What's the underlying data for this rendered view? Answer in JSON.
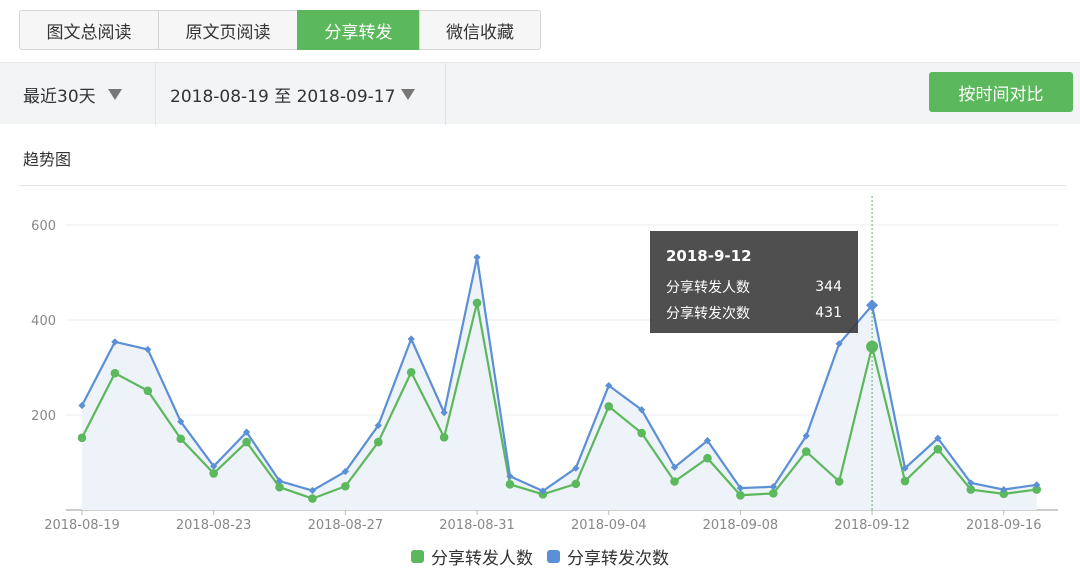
{
  "tabs": [
    {
      "label": "图文总阅读",
      "active": false
    },
    {
      "label": "原文页阅读",
      "active": false
    },
    {
      "label": "分享转发",
      "active": true
    },
    {
      "label": "微信收藏",
      "active": false
    }
  ],
  "filters": {
    "period": "最近30天",
    "date_range": "2018-08-19 至 2018-09-17",
    "compare_button": "按时间对比"
  },
  "section_title": "趋势图",
  "colors": {
    "accent": "#5cb85c",
    "series_green": "#5cb85c",
    "series_blue": "#5b8fd6"
  },
  "tooltip": {
    "date": "2018-9-12",
    "rows": [
      {
        "label": "分享转发人数",
        "value": "344"
      },
      {
        "label": "分享转发次数",
        "value": "431"
      }
    ]
  },
  "legend": [
    {
      "label": "分享转发人数",
      "color": "#5cb85c"
    },
    {
      "label": "分享转发次数",
      "color": "#5b8fd6"
    }
  ],
  "chart_data": {
    "type": "line",
    "title": "",
    "xlabel": "",
    "ylabel": "",
    "ylim": [
      0,
      600
    ],
    "yticks": [
      200,
      400,
      600
    ],
    "xtick_labels": [
      "2018-08-19",
      "2018-08-23",
      "2018-08-27",
      "2018-08-31",
      "2018-09-04",
      "2018-09-08",
      "2018-09-12",
      "2018-09-16"
    ],
    "xtick_index": [
      0,
      4,
      8,
      12,
      16,
      20,
      24,
      28
    ],
    "x": [
      "2018-08-19",
      "2018-08-20",
      "2018-08-21",
      "2018-08-22",
      "2018-08-23",
      "2018-08-24",
      "2018-08-25",
      "2018-08-26",
      "2018-08-27",
      "2018-08-28",
      "2018-08-29",
      "2018-08-30",
      "2018-08-31",
      "2018-09-01",
      "2018-09-02",
      "2018-09-03",
      "2018-09-04",
      "2018-09-05",
      "2018-09-06",
      "2018-09-07",
      "2018-09-08",
      "2018-09-09",
      "2018-09-10",
      "2018-09-11",
      "2018-09-12",
      "2018-09-13",
      "2018-09-14",
      "2018-09-15",
      "2018-09-16",
      "2018-09-17"
    ],
    "highlight_index": 24,
    "grid": true,
    "legend_position": "bottom",
    "series": [
      {
        "name": "分享转发人数",
        "color": "#5cb85c",
        "values": [
          152,
          288,
          251,
          150,
          77,
          143,
          48,
          24,
          50,
          143,
          290,
          153,
          436,
          54,
          33,
          55,
          218,
          162,
          60,
          109,
          31,
          35,
          123,
          60,
          344,
          61,
          128,
          43,
          34,
          43
        ]
      },
      {
        "name": "分享转发次数",
        "color": "#5b8fd6",
        "values": [
          220,
          354,
          338,
          186,
          92,
          164,
          61,
          41,
          81,
          178,
          360,
          205,
          532,
          71,
          40,
          88,
          262,
          211,
          90,
          146,
          46,
          49,
          156,
          350,
          431,
          88,
          151,
          57,
          43,
          53
        ]
      }
    ]
  }
}
